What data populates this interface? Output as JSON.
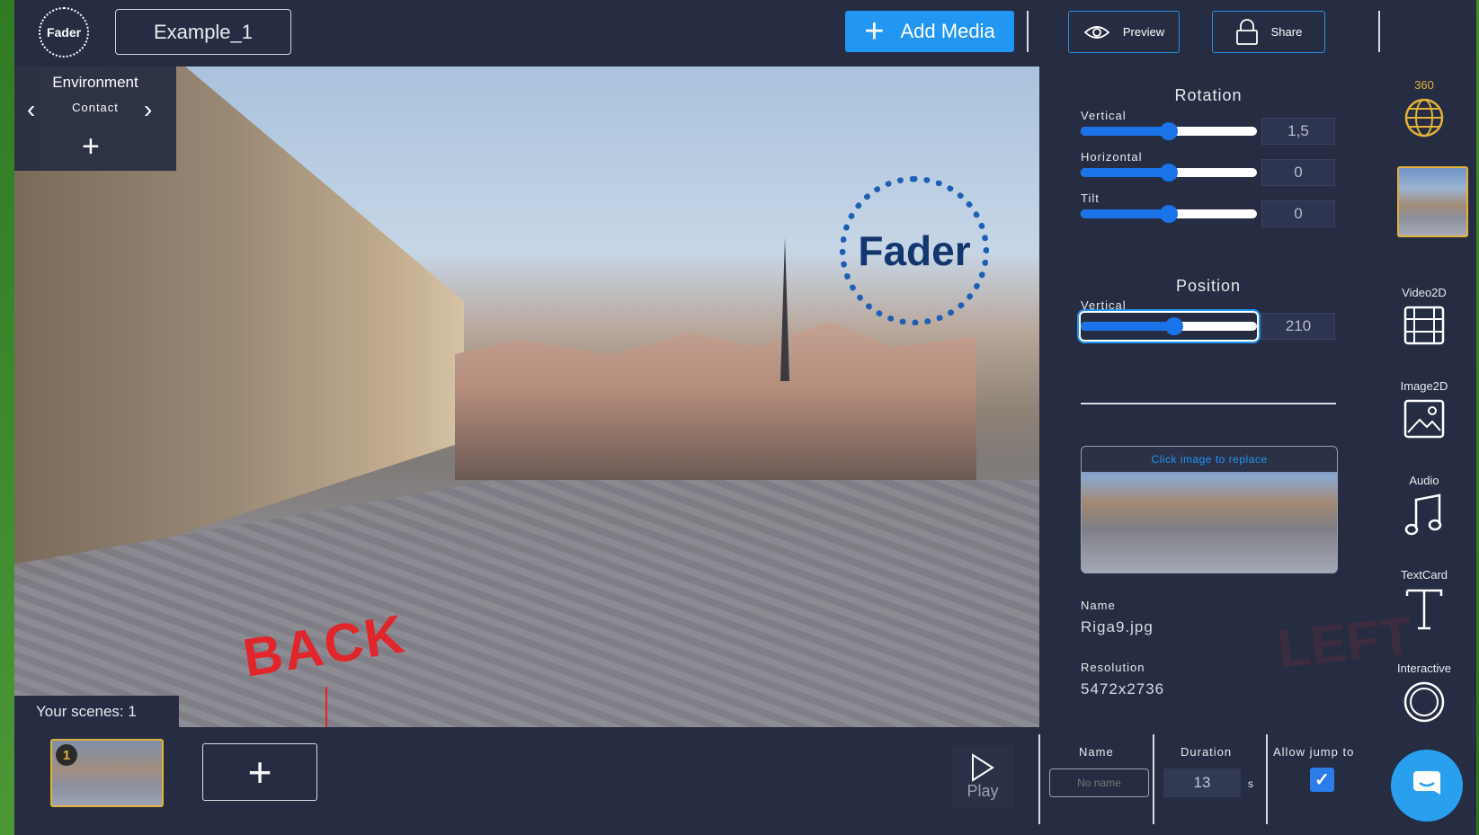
{
  "app": {
    "logo_text": "Fader",
    "project_name": "Example_1"
  },
  "toolbar": {
    "add_media_label": "Add Media",
    "preview_label": "Preview",
    "share_label": "Share"
  },
  "environment": {
    "title": "Environment",
    "current": "Contact"
  },
  "viewport": {
    "watermark": "Fader",
    "hotspot_text": "BACK",
    "ghost_text": "LEFT"
  },
  "scenes": {
    "label": "Your scenes: 1",
    "items": [
      {
        "number": "1"
      }
    ]
  },
  "rotation": {
    "title": "Rotation",
    "vertical": {
      "label": "Vertical",
      "value": "1,5",
      "slider_fraction": 0.5
    },
    "horizontal": {
      "label": "Horizontal",
      "value": "0",
      "slider_fraction": 0.5
    },
    "tilt": {
      "label": "Tilt",
      "value": "0",
      "slider_fraction": 0.5
    }
  },
  "position": {
    "title": "Position",
    "vertical": {
      "label": "Vertical",
      "value": "210",
      "slider_fraction": 0.53
    }
  },
  "media": {
    "replace_hint": "Click image to replace",
    "name_label": "Name",
    "name_value": "Riga9.jpg",
    "resolution_label": "Resolution",
    "resolution_value": "5472x2736"
  },
  "right_toolbar": {
    "items": [
      {
        "label": "360",
        "icon": "globe-icon"
      },
      {
        "label": "Video2D",
        "icon": "film-icon"
      },
      {
        "label": "Image2D",
        "icon": "image-icon"
      },
      {
        "label": "Audio",
        "icon": "music-note-icon"
      },
      {
        "label": "TextCard",
        "icon": "text-icon"
      },
      {
        "label": "Interactive",
        "icon": "circle-icon"
      }
    ]
  },
  "bottom": {
    "play_label": "Play",
    "name_label": "Name",
    "name_placeholder": "No name",
    "duration_label": "Duration",
    "duration_value": "13",
    "duration_unit": "s",
    "allow_jump_label": "Allow jump to",
    "allow_jump_checked": true
  },
  "colors": {
    "bg": "#262d42",
    "accent": "#2196f3",
    "highlight": "#e2b13a",
    "hotspot": "#e0262b"
  }
}
